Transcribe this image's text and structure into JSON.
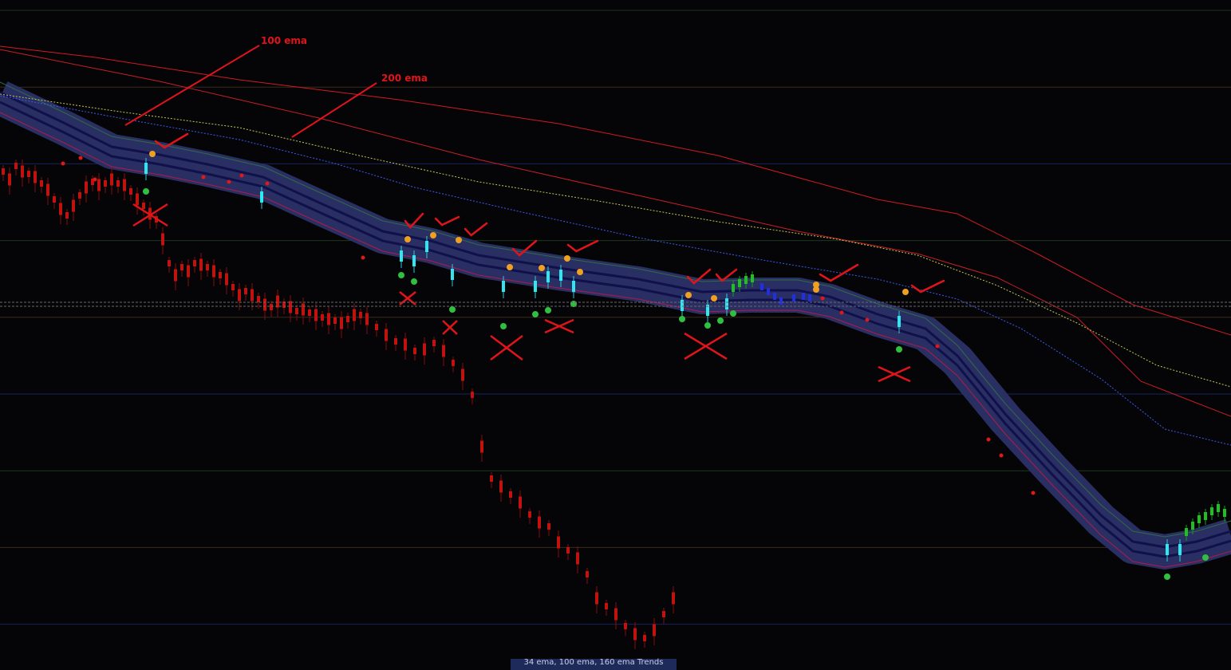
{
  "chart_data": {
    "type": "line",
    "title": "",
    "xlabel": "",
    "ylabel": "",
    "grid": true,
    "annotations": [
      {
        "id": "ema100",
        "text": "100 ema"
      },
      {
        "id": "ema200",
        "text": "200 ema"
      }
    ],
    "series": [
      {
        "style": "solid red line",
        "color": "#d01a22",
        "values": [
          [
            0,
            58
          ],
          [
            120,
            72
          ],
          [
            300,
            100
          ],
          [
            500,
            125
          ],
          [
            700,
            155
          ],
          [
            900,
            195
          ],
          [
            1100,
            250
          ],
          [
            1200,
            268
          ],
          [
            1300,
            318
          ],
          [
            1420,
            382
          ],
          [
            1543,
            420
          ]
        ]
      },
      {
        "style": "solid red line",
        "color": "#c81e26",
        "values": [
          [
            0,
            62
          ],
          [
            200,
            102
          ],
          [
            400,
            148
          ],
          [
            600,
            200
          ],
          [
            800,
            245
          ],
          [
            1000,
            290
          ],
          [
            1150,
            318
          ],
          [
            1250,
            348
          ],
          [
            1350,
            398
          ],
          [
            1430,
            478
          ],
          [
            1543,
            522
          ]
        ]
      },
      {
        "style": "dotted yellow line",
        "color": "#c8c850",
        "values": [
          [
            0,
            118
          ],
          [
            150,
            140
          ],
          [
            300,
            160
          ],
          [
            450,
            195
          ],
          [
            600,
            228
          ],
          [
            750,
            252
          ],
          [
            900,
            278
          ],
          [
            1050,
            300
          ],
          [
            1150,
            320
          ],
          [
            1250,
            358
          ],
          [
            1350,
            405
          ],
          [
            1450,
            458
          ],
          [
            1543,
            485
          ]
        ]
      },
      {
        "style": "dotted blue line",
        "color": "#3a5cf0",
        "values": [
          [
            0,
            120
          ],
          [
            150,
            148
          ],
          [
            300,
            175
          ],
          [
            420,
            205
          ],
          [
            520,
            235
          ],
          [
            650,
            265
          ],
          [
            800,
            298
          ],
          [
            950,
            325
          ],
          [
            1100,
            350
          ],
          [
            1200,
            375
          ],
          [
            1280,
            412
          ],
          [
            1380,
            475
          ],
          [
            1460,
            538
          ],
          [
            1543,
            558
          ]
        ]
      },
      {
        "style": "band center",
        "color": "#0c0c48",
        "values": [
          [
            0,
            122
          ],
          [
            80,
            160
          ],
          [
            140,
            190
          ],
          [
            200,
            200
          ],
          [
            260,
            212
          ],
          [
            330,
            228
          ],
          [
            400,
            260
          ],
          [
            480,
            296
          ],
          [
            540,
            308
          ],
          [
            600,
            326
          ],
          [
            700,
            342
          ],
          [
            800,
            356
          ],
          [
            880,
            372
          ],
          [
            940,
            370
          ],
          [
            1000,
            370
          ],
          [
            1040,
            378
          ],
          [
            1100,
            400
          ],
          [
            1160,
            418
          ],
          [
            1200,
            452
          ],
          [
            1260,
            525
          ],
          [
            1320,
            590
          ],
          [
            1380,
            652
          ],
          [
            1420,
            685
          ],
          [
            1460,
            692
          ],
          [
            1500,
            685
          ],
          [
            1543,
            672
          ]
        ]
      }
    ],
    "candles_up": {
      "color": "#30e7f0",
      "x": [
        183,
        328,
        503,
        519,
        535,
        567,
        631,
        671,
        687,
        703,
        719,
        855,
        887,
        911,
        1127,
        1463,
        1479
      ],
      "y": [
        212,
        248,
        322,
        328,
        310,
        345,
        360,
        360,
        348,
        346,
        360,
        384,
        390,
        382,
        404,
        690,
        690
      ]
    },
    "candles_green": {
      "color": "#20c020",
      "x": [
        919,
        927,
        935,
        943,
        1487,
        1495,
        1503,
        1511,
        1519,
        1527,
        1535
      ],
      "y": [
        362,
        356,
        352,
        350,
        668,
        660,
        652,
        648,
        642,
        638,
        644
      ]
    },
    "candles_down": {
      "color": "#b80e10",
      "values_y": [
        215,
        225,
        208,
        215,
        218,
        222,
        230,
        238,
        250,
        262,
        270,
        258,
        245,
        235,
        228,
        232,
        230,
        225,
        230,
        232,
        240,
        250,
        258,
        268,
        275,
        300,
        330,
        345,
        335,
        340,
        330,
        332,
        335,
        340,
        345,
        350,
        360,
        370,
        365,
        370,
        375,
        382,
        385,
        378,
        382,
        385,
        390,
        388,
        392,
        395,
        398,
        400,
        402,
        405,
        400,
        395,
        395,
        400,
        410,
        420,
        428,
        432,
        440,
        438,
        430,
        440,
        455,
        470,
        495,
        560,
        600,
        610,
        620,
        630,
        645,
        655,
        660,
        680,
        690,
        700,
        720,
        750,
        760,
        770,
        785,
        795,
        800,
        790,
        770,
        750
      ]
    },
    "dots": {
      "orange": [
        [
          191,
          193
        ],
        [
          511,
          300
        ],
        [
          543,
          295
        ],
        [
          575,
          301
        ],
        [
          639,
          335
        ],
        [
          679,
          336
        ],
        [
          711,
          324
        ],
        [
          727,
          341
        ],
        [
          863,
          370
        ],
        [
          895,
          374
        ],
        [
          1023,
          357
        ],
        [
          1023,
          363
        ],
        [
          1135,
          366
        ]
      ],
      "green": [
        [
          183,
          240
        ],
        [
          503,
          345
        ],
        [
          519,
          353
        ],
        [
          567,
          388
        ],
        [
          631,
          409
        ],
        [
          671,
          394
        ],
        [
          687,
          389
        ],
        [
          719,
          381
        ],
        [
          855,
          400
        ],
        [
          887,
          408
        ],
        [
          903,
          402
        ],
        [
          919,
          393
        ],
        [
          1127,
          438
        ],
        [
          1463,
          723
        ],
        [
          1511,
          699
        ]
      ],
      "red": [
        [
          119,
          225
        ],
        [
          79,
          205
        ],
        [
          101,
          198
        ],
        [
          255,
          222
        ],
        [
          287,
          228
        ],
        [
          303,
          220
        ],
        [
          335,
          230
        ],
        [
          455,
          323
        ],
        [
          1031,
          374
        ],
        [
          1055,
          392
        ],
        [
          1087,
          401
        ],
        [
          1175,
          434
        ],
        [
          1239,
          551
        ],
        [
          1255,
          571
        ],
        [
          1295,
          618
        ]
      ]
    },
    "checks": [
      [
        195,
        185,
        235,
        168
      ],
      [
        508,
        285,
        530,
        268
      ],
      [
        546,
        282,
        575,
        272
      ],
      [
        583,
        295,
        610,
        280
      ],
      [
        643,
        320,
        672,
        302
      ],
      [
        712,
        315,
        749,
        302
      ],
      [
        862,
        355,
        890,
        338
      ],
      [
        898,
        352,
        923,
        338
      ],
      [
        1028,
        352,
        1075,
        332
      ],
      [
        1143,
        366,
        1183,
        352
      ]
    ],
    "crosses": [
      [
        167,
        256,
        210,
        283
      ],
      [
        501,
        366,
        521,
        382
      ],
      [
        555,
        402,
        573,
        419
      ],
      [
        615,
        421,
        655,
        451
      ],
      [
        683,
        401,
        719,
        417
      ],
      [
        858,
        418,
        911,
        450
      ],
      [
        1101,
        460,
        1141,
        478
      ]
    ]
  },
  "bottom_tab": {
    "text": "34 ema, 100 ema, 160 ema Trends"
  }
}
